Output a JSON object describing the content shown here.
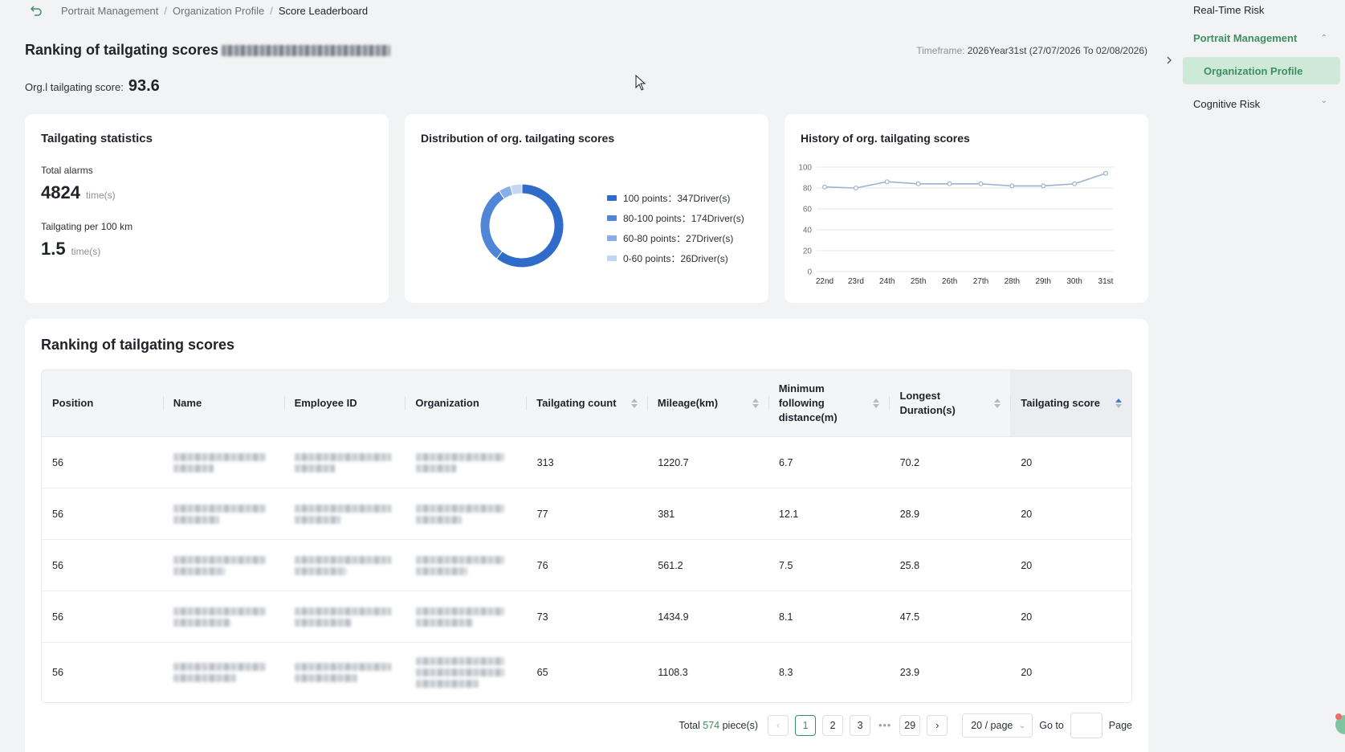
{
  "breadcrumb": {
    "items": [
      "Portrait Management",
      "Organization Profile",
      "Score Leaderboard"
    ],
    "separator": "/"
  },
  "header": {
    "title": "Ranking of tailgating scores",
    "timeframe_label": "Timeframe:",
    "timeframe_value": "2026Year31st (27/07/2026 To 02/08/2026)",
    "org_score_label": "Org.l tailgating score:",
    "org_score_value": "93.6"
  },
  "stats": {
    "title": "Tailgating statistics",
    "total_alarms_label": "Total alarms",
    "total_alarms_value": "4824",
    "total_alarms_unit": "time(s)",
    "per100_label": "Tailgating per 100 km",
    "per100_value": "1.5",
    "per100_unit": "time(s)"
  },
  "distribution": {
    "title": "Distribution of org. tailgating scores",
    "legend": [
      {
        "label": "100 points：347Driver(s)",
        "color": "#2f6bc8"
      },
      {
        "label": "80-100 points：174Driver(s)",
        "color": "#4f86d6"
      },
      {
        "label": "60-80 points：27Driver(s)",
        "color": "#89aee6"
      },
      {
        "label": "0-60 points：26Driver(s)",
        "color": "#c3d6f3"
      }
    ]
  },
  "history": {
    "title": "History of org. tailgating scores"
  },
  "chart_data": [
    {
      "type": "pie",
      "title": "Distribution of org. tailgating scores",
      "categories": [
        "100 points",
        "80-100 points",
        "60-80 points",
        "0-60 points"
      ],
      "values": [
        347,
        174,
        27,
        26
      ],
      "colors": [
        "#2f6bc8",
        "#4f86d6",
        "#89aee6",
        "#c3d6f3"
      ],
      "donut": true
    },
    {
      "type": "line",
      "title": "History of org. tailgating scores",
      "categories": [
        "22nd",
        "23rd",
        "24th",
        "25th",
        "26th",
        "27th",
        "28th",
        "29th",
        "30th",
        "31st"
      ],
      "values": [
        81,
        80,
        86,
        84,
        84,
        84,
        82,
        82,
        84,
        94
      ],
      "yticks": [
        0,
        20,
        40,
        60,
        80,
        100
      ],
      "ylim": [
        0,
        100
      ],
      "grid": true,
      "color": "#9fb3d1"
    }
  ],
  "ranking": {
    "title": "Ranking of tailgating scores",
    "columns": [
      "Position",
      "Name",
      "Employee ID",
      "Organization",
      "Tailgating count",
      "Mileage(km)",
      "Minimum following distance(m)",
      "Longest Duration(s)",
      "Tailgating score"
    ],
    "rows": [
      {
        "position": "56",
        "count": "313",
        "mileage": "1220.7",
        "min_dist": "6.7",
        "duration": "70.2",
        "score": "20"
      },
      {
        "position": "56",
        "count": "77",
        "mileage": "381",
        "min_dist": "12.1",
        "duration": "28.9",
        "score": "20"
      },
      {
        "position": "56",
        "count": "76",
        "mileage": "561.2",
        "min_dist": "7.5",
        "duration": "25.8",
        "score": "20"
      },
      {
        "position": "56",
        "count": "73",
        "mileage": "1434.9",
        "min_dist": "8.1",
        "duration": "47.5",
        "score": "20"
      },
      {
        "position": "56",
        "count": "65",
        "mileage": "1108.3",
        "min_dist": "8.3",
        "duration": "23.9",
        "score": "20"
      }
    ]
  },
  "pagination": {
    "total_prefix": "Total",
    "total_count": "574",
    "total_suffix": "piece(s)",
    "pages": [
      "1",
      "2",
      "3"
    ],
    "ellipsis": "•••",
    "last_page": "29",
    "page_size": "20 / page",
    "goto_label": "Go to",
    "page_label": "Page"
  },
  "sidenav": {
    "realtime": "Real-Time Risk",
    "portrait": "Portrait Management",
    "org_profile": "Organization Profile",
    "cognitive": "Cognitive Risk"
  }
}
